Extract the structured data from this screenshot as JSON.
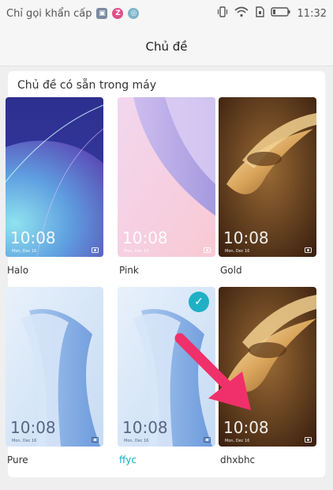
{
  "status_bar": {
    "carrier_text": "Chỉ gọi khẩn cấp",
    "icons": [
      "gallery-icon",
      "zalo-icon",
      "chrome-icon"
    ],
    "right_icons": [
      "vibrate-icon",
      "wifi-icon",
      "sim-icon",
      "battery-icon"
    ],
    "time": "11:32"
  },
  "header": {
    "title": "Chủ đề"
  },
  "section": {
    "title": "Chủ đề có sẵn trong máy"
  },
  "themes": [
    {
      "name": "Halo",
      "clock": "10:08",
      "date": "Mon, Dec 16",
      "selected": false
    },
    {
      "name": "Pink",
      "clock": "10:08",
      "date": "Mon, Dec 16",
      "selected": false
    },
    {
      "name": "Gold",
      "clock": "10:08",
      "date": "Mon, Dec 16",
      "selected": false
    },
    {
      "name": "Pure",
      "clock": "10:08",
      "date": "Mon, Dec 16",
      "selected": false
    },
    {
      "name": "ffyc",
      "clock": "10:08",
      "date": "Mon, Dec 16",
      "selected": true
    },
    {
      "name": "dhxbhc",
      "clock": "10:08",
      "date": "Mon, Dec 16",
      "selected": false
    }
  ],
  "colors": {
    "accent": "#1fb0c6",
    "annotation_arrow": "#f0306a"
  }
}
